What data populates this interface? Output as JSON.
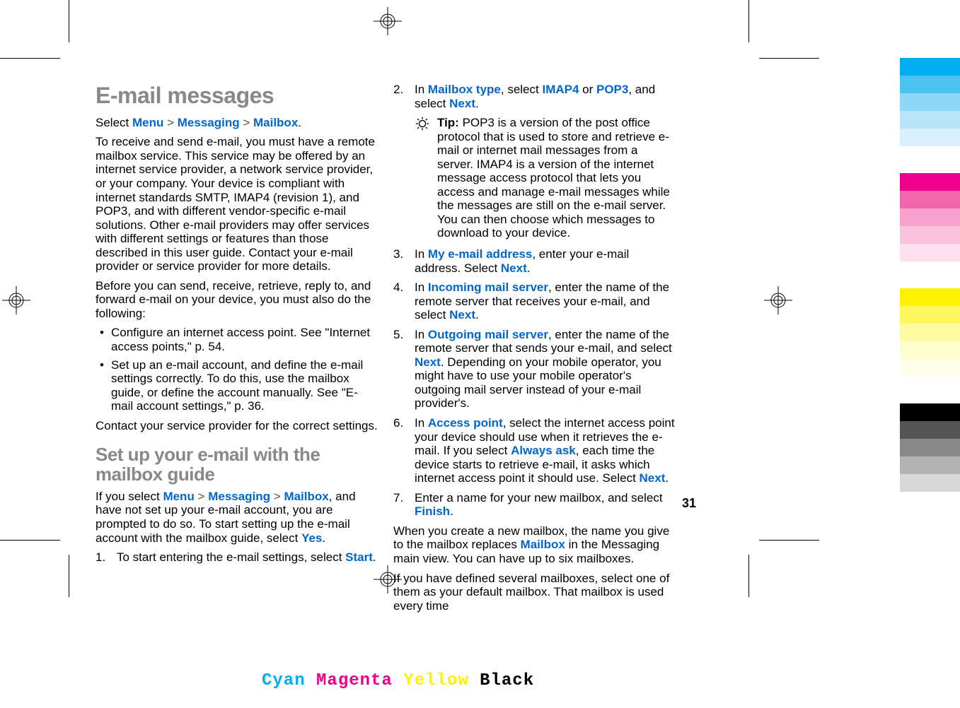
{
  "page_number": "31",
  "heading1": "E-mail messages",
  "nav": {
    "menu": "Menu",
    "messaging": "Messaging",
    "mailbox": "Mailbox",
    "sep": " > "
  },
  "intro_prefix": "Select ",
  "intro_suffix": ".",
  "para1": "To receive and send e-mail, you must have a remote mailbox service. This service may be offered by an internet service provider, a network service provider, or your company. Your device is compliant with internet standards SMTP, IMAP4 (revision 1), and POP3, and with different vendor-specific e-mail solutions. Other e-mail providers may offer services with different settings or features than those described in this user guide. Contact your e-mail provider or service provider for more details.",
  "para2": "Before you can send, receive, retrieve, reply to, and forward e-mail on your device, you must also do the following:",
  "bullet1": "Configure an internet access point. See \"Internet access points,\" p. 54.",
  "bullet2": "Set up an e-mail account, and define the e-mail settings correctly. To do this, use the mailbox guide, or define the account manually. See \"E-mail account settings,\" p. 36.",
  "para3": "Contact your service provider for the correct settings.",
  "heading2": "Set up your e-mail with the mailbox guide",
  "setup_intro_1": "If you select ",
  "setup_intro_2": ", and have not set up your e-mail account, you are prompted to do so. To start setting up the e-mail account with the mailbox guide, select ",
  "yes": "Yes",
  "period": ".",
  "step1_num": "1.",
  "step1_a": "To start entering the e-mail settings, select ",
  "start": "Start",
  "step2_num": "2.",
  "step2_a": "In ",
  "mailbox_type": "Mailbox type",
  "step2_b": ", select ",
  "imap4": "IMAP4",
  "or": " or ",
  "pop3": "POP3",
  "step2_c": ", and select ",
  "next": "Next",
  "tip_label": "Tip: ",
  "tip_text": "POP3 is a version of the post office protocol that is used to store and retrieve e-mail or internet mail messages from a server. IMAP4 is a version of the internet message access protocol that lets you access and manage e-mail messages while the messages are still on the e-mail server. You can then choose which messages to download to your device.",
  "step3_num": "3.",
  "step3_a": "In ",
  "my_email": "My e-mail address",
  "step3_b": ", enter your e-mail address. Select ",
  "step4_num": "4.",
  "step4_a": "In ",
  "incoming": "Incoming mail server",
  "step4_b": ", enter the name of the remote server that receives your e-mail, and select ",
  "step5_num": "5.",
  "step5_a": "In ",
  "outgoing": "Outgoing mail server",
  "step5_b": ", enter the name of the remote server that sends your e-mail, and select ",
  "step5_c": ". Depending on your mobile operator, you might have to use your mobile operator's outgoing mail server instead of your e-mail provider's.",
  "step6_num": "6.",
  "step6_a": "In ",
  "access_point": "Access point",
  "step6_b": ", select the internet access point your device should use when it retrieves the e-mail. If you select ",
  "always_ask": "Always ask",
  "step6_c": ", each time the device starts to retrieve e-mail, it asks which internet access point it should use. Select ",
  "step7_num": "7.",
  "step7_a": "Enter a name for your new mailbox, and select ",
  "finish": "Finish",
  "closing1_a": "When you create a new mailbox, the name you give to the mailbox replaces ",
  "closing1_b": " in the Messaging main view. You can have up to six mailboxes.",
  "closing2": "If you have defined several mailboxes, select one of them as your default mailbox. That mailbox is used every time",
  "cmyk": {
    "c": "Cyan",
    "m": "Magenta",
    "y": "Yellow",
    "k": "Black"
  },
  "colorbar": {
    "set1": [
      "#00aeef",
      "#49c2f1",
      "#8dd7f7",
      "#b9e5fa",
      "#d9f0fc"
    ],
    "set2": [
      "#ec008c",
      "#f067ae",
      "#f6a0cb",
      "#fac3de",
      "#fde1ee"
    ],
    "set3": [
      "#fff200",
      "#fff761",
      "#fffba3",
      "#fffdd0",
      "#fffeea"
    ],
    "set4": [
      "#000000",
      "#555555",
      "#888888",
      "#b3b3b3",
      "#d9d9d9"
    ]
  }
}
